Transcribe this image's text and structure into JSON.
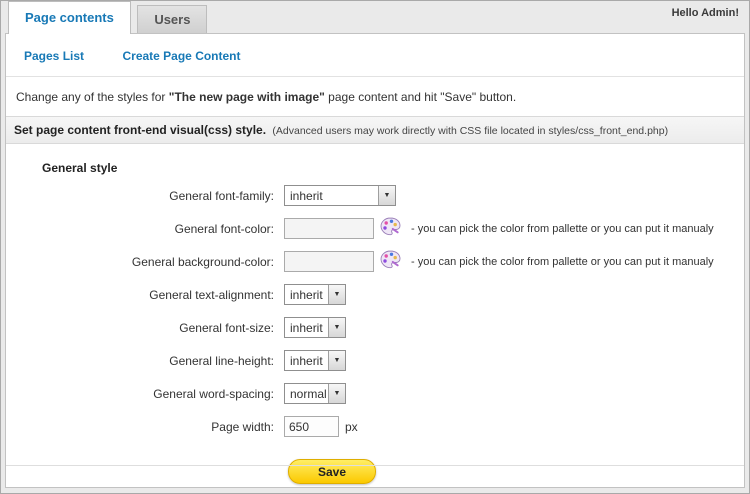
{
  "header": {
    "greeting": "Hello Admin!",
    "tabs": {
      "page_contents": "Page contents",
      "users": "Users"
    }
  },
  "subnav": {
    "pages_list": "Pages List",
    "create_page_content": "Create Page Content"
  },
  "intro": {
    "prefix": "Change any of the styles for ",
    "page_name": "\"The new page with image\"",
    "suffix": " page content and hit \"Save\" button."
  },
  "section": {
    "title": "Set page content front-end visual(css) style.",
    "note": "(Advanced users may work directly with CSS file located in styles/css_front_end.php)"
  },
  "group_title": "General style",
  "form": {
    "font_family": {
      "label": "General font-family:",
      "value": "inherit"
    },
    "font_color": {
      "label": "General font-color:",
      "value": ""
    },
    "background_color": {
      "label": "General background-color:",
      "value": ""
    },
    "text_alignment": {
      "label": "General text-alignment:",
      "value": "inherit"
    },
    "font_size": {
      "label": "General font-size:",
      "value": "inherit"
    },
    "line_height": {
      "label": "General line-height:",
      "value": "inherit"
    },
    "word_spacing": {
      "label": "General word-spacing:",
      "value": "normal"
    },
    "page_width": {
      "label": "Page width:",
      "value": "650",
      "suffix": "px"
    },
    "color_hint": "- you can pick the color from pallette or you can put it manualy",
    "save_label": "Save"
  },
  "colors": {
    "accent_blue": "#1879b6",
    "save_yellow": "#fbc900"
  }
}
